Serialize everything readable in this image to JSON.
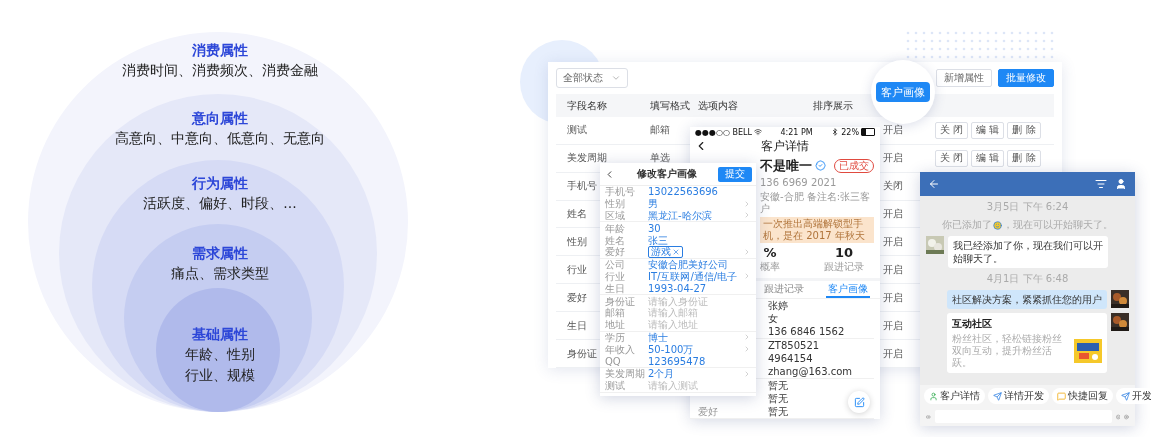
{
  "diagram": {
    "layers": [
      {
        "title": "消费属性",
        "lines": [
          "消费时间、消费频次、消费金融"
        ]
      },
      {
        "title": "意向属性",
        "lines": [
          "高意向、中意向、低意向、无意向"
        ]
      },
      {
        "title": "行为属性",
        "lines": [
          "活跃度、偏好、时段、..."
        ]
      },
      {
        "title": "需求属性",
        "lines": [
          "痛点、需求类型"
        ]
      },
      {
        "title": "基础属性",
        "lines": [
          "年龄、性别",
          "行业、规模"
        ]
      }
    ]
  },
  "attribute_table": {
    "filter": {
      "value": "全部状态"
    },
    "buttons": [
      {
        "label": "新增属性",
        "kind": "secondary"
      },
      {
        "label": "批量修改",
        "kind": "primary"
      }
    ],
    "columns": [
      "字段名称",
      "填写格式",
      "选项内容",
      "排序展示"
    ],
    "rows": [
      {
        "name": "测试",
        "format": "邮箱",
        "status": "开启",
        "actions": [
          "关 闭",
          "编 辑",
          "删 除"
        ]
      },
      {
        "name": "美发周期",
        "format": "单选",
        "status": "开启",
        "actions": [
          "关 闭",
          "编 辑",
          "删 除"
        ]
      },
      {
        "name": "手机号",
        "status": "关闭"
      },
      {
        "name": "姓名",
        "status": "开启"
      },
      {
        "name": "性别",
        "status": "开启"
      },
      {
        "name": "行业",
        "status": "开启"
      },
      {
        "name": "爱好",
        "status": "开启"
      },
      {
        "name": "生日",
        "status": "开启"
      },
      {
        "name": "身份证",
        "status": "开启"
      }
    ]
  },
  "highlight_button": {
    "label": "客户画像"
  },
  "edit_panel": {
    "title": "修改客户画像",
    "submit": "提交",
    "groups": [
      [
        {
          "label": "手机号",
          "value": "13022563696",
          "kind": "value",
          "chevron": false
        },
        {
          "label": "性别",
          "value": "男",
          "kind": "value",
          "chevron": true
        },
        {
          "label": "区域",
          "value": "黑龙江-哈尔滨",
          "kind": "value",
          "chevron": true
        }
      ],
      [
        {
          "label": "年龄",
          "value": "30",
          "kind": "value",
          "chevron": false
        },
        {
          "label": "姓名",
          "value": "张三",
          "kind": "value",
          "chevron": false
        },
        {
          "label": "爱好",
          "value": "游戏",
          "kind": "tag",
          "chevron": true
        }
      ],
      [
        {
          "label": "公司",
          "value": "安徽合肥美好公司",
          "kind": "value",
          "chevron": false
        },
        {
          "label": "行业",
          "value": "IT/互联网/通信/电子",
          "kind": "value",
          "chevron": true
        },
        {
          "label": "生日",
          "value": "1993-04-27",
          "kind": "value",
          "chevron": false
        }
      ],
      [
        {
          "label": "身份证",
          "placeholder": "请输入身份证",
          "kind": "field",
          "chevron": false
        },
        {
          "label": "邮箱",
          "placeholder": "请输入邮箱",
          "kind": "field",
          "chevron": false
        },
        {
          "label": "地址",
          "placeholder": "请输入地址",
          "kind": "field",
          "chevron": false
        }
      ],
      [
        {
          "label": "学历",
          "value": "博士",
          "kind": "value",
          "chevron": true
        },
        {
          "label": "年收入",
          "value": "50-100万",
          "kind": "value",
          "chevron": true
        },
        {
          "label": "QQ",
          "value": "123695478",
          "kind": "value",
          "chevron": false
        }
      ],
      [
        {
          "label": "美发周期",
          "value": "2个月",
          "kind": "value",
          "chevron": true
        },
        {
          "label": "测试",
          "placeholder": "请输入测试",
          "kind": "field",
          "chevron": false
        }
      ]
    ]
  },
  "detail_phone": {
    "status_bar": {
      "carrier": "●●●○○ BELL",
      "time": "4:21 PM",
      "battery": "22%"
    },
    "title": "客户详情",
    "customer": {
      "name": "不是唯一",
      "tag": "已成交",
      "lines": [
        "136 6969 2021",
        "安徽-合肥  备注名:张三客户"
      ],
      "note": "一次推出高端解锁型手机，是在 2017 年秋天"
    },
    "stats": [
      {
        "value": "%",
        "label": "概率"
      },
      {
        "value": "10",
        "label": "跟进记录"
      }
    ],
    "tabs": [
      {
        "label": "跟进记录",
        "selected": false
      },
      {
        "label": "客户画像",
        "selected": true
      }
    ],
    "groups": [
      [
        {
          "value": "张婷"
        },
        {
          "value": "女"
        },
        {
          "value": "136 6846 1562"
        }
      ],
      [
        {
          "value": "ZT850521"
        },
        {
          "value": "4964154"
        },
        {
          "value": "zhang@163.com"
        }
      ],
      [
        {
          "value": "暂无"
        },
        {
          "value": "暂无"
        },
        {
          "label": "爱好",
          "value": "暂无"
        }
      ]
    ]
  },
  "chat": {
    "messages": [
      {
        "kind": "time",
        "text": "3月5日  下午 6:24"
      },
      {
        "kind": "system",
        "before": "你已添加了",
        "after": "，现在可以开始聊天了。"
      },
      {
        "kind": "incoming",
        "text": "我已经添加了你，现在我们可以开始聊天了。"
      },
      {
        "kind": "time",
        "text": "4月1日  下午 6:48"
      },
      {
        "kind": "outgoing",
        "text": "社区解决方案，紧紧抓住您的用户"
      },
      {
        "kind": "card",
        "title": "互动社区",
        "text": "粉丝社区，轻松链接粉丝双向互动，提升粉丝活跃。"
      }
    ],
    "chips": [
      {
        "label": "客户详情",
        "kind": "person"
      },
      {
        "label": "详情开发",
        "kind": "send"
      },
      {
        "label": "快捷回复",
        "kind": "reply"
      },
      {
        "label": "开发",
        "kind": "send"
      }
    ]
  }
}
